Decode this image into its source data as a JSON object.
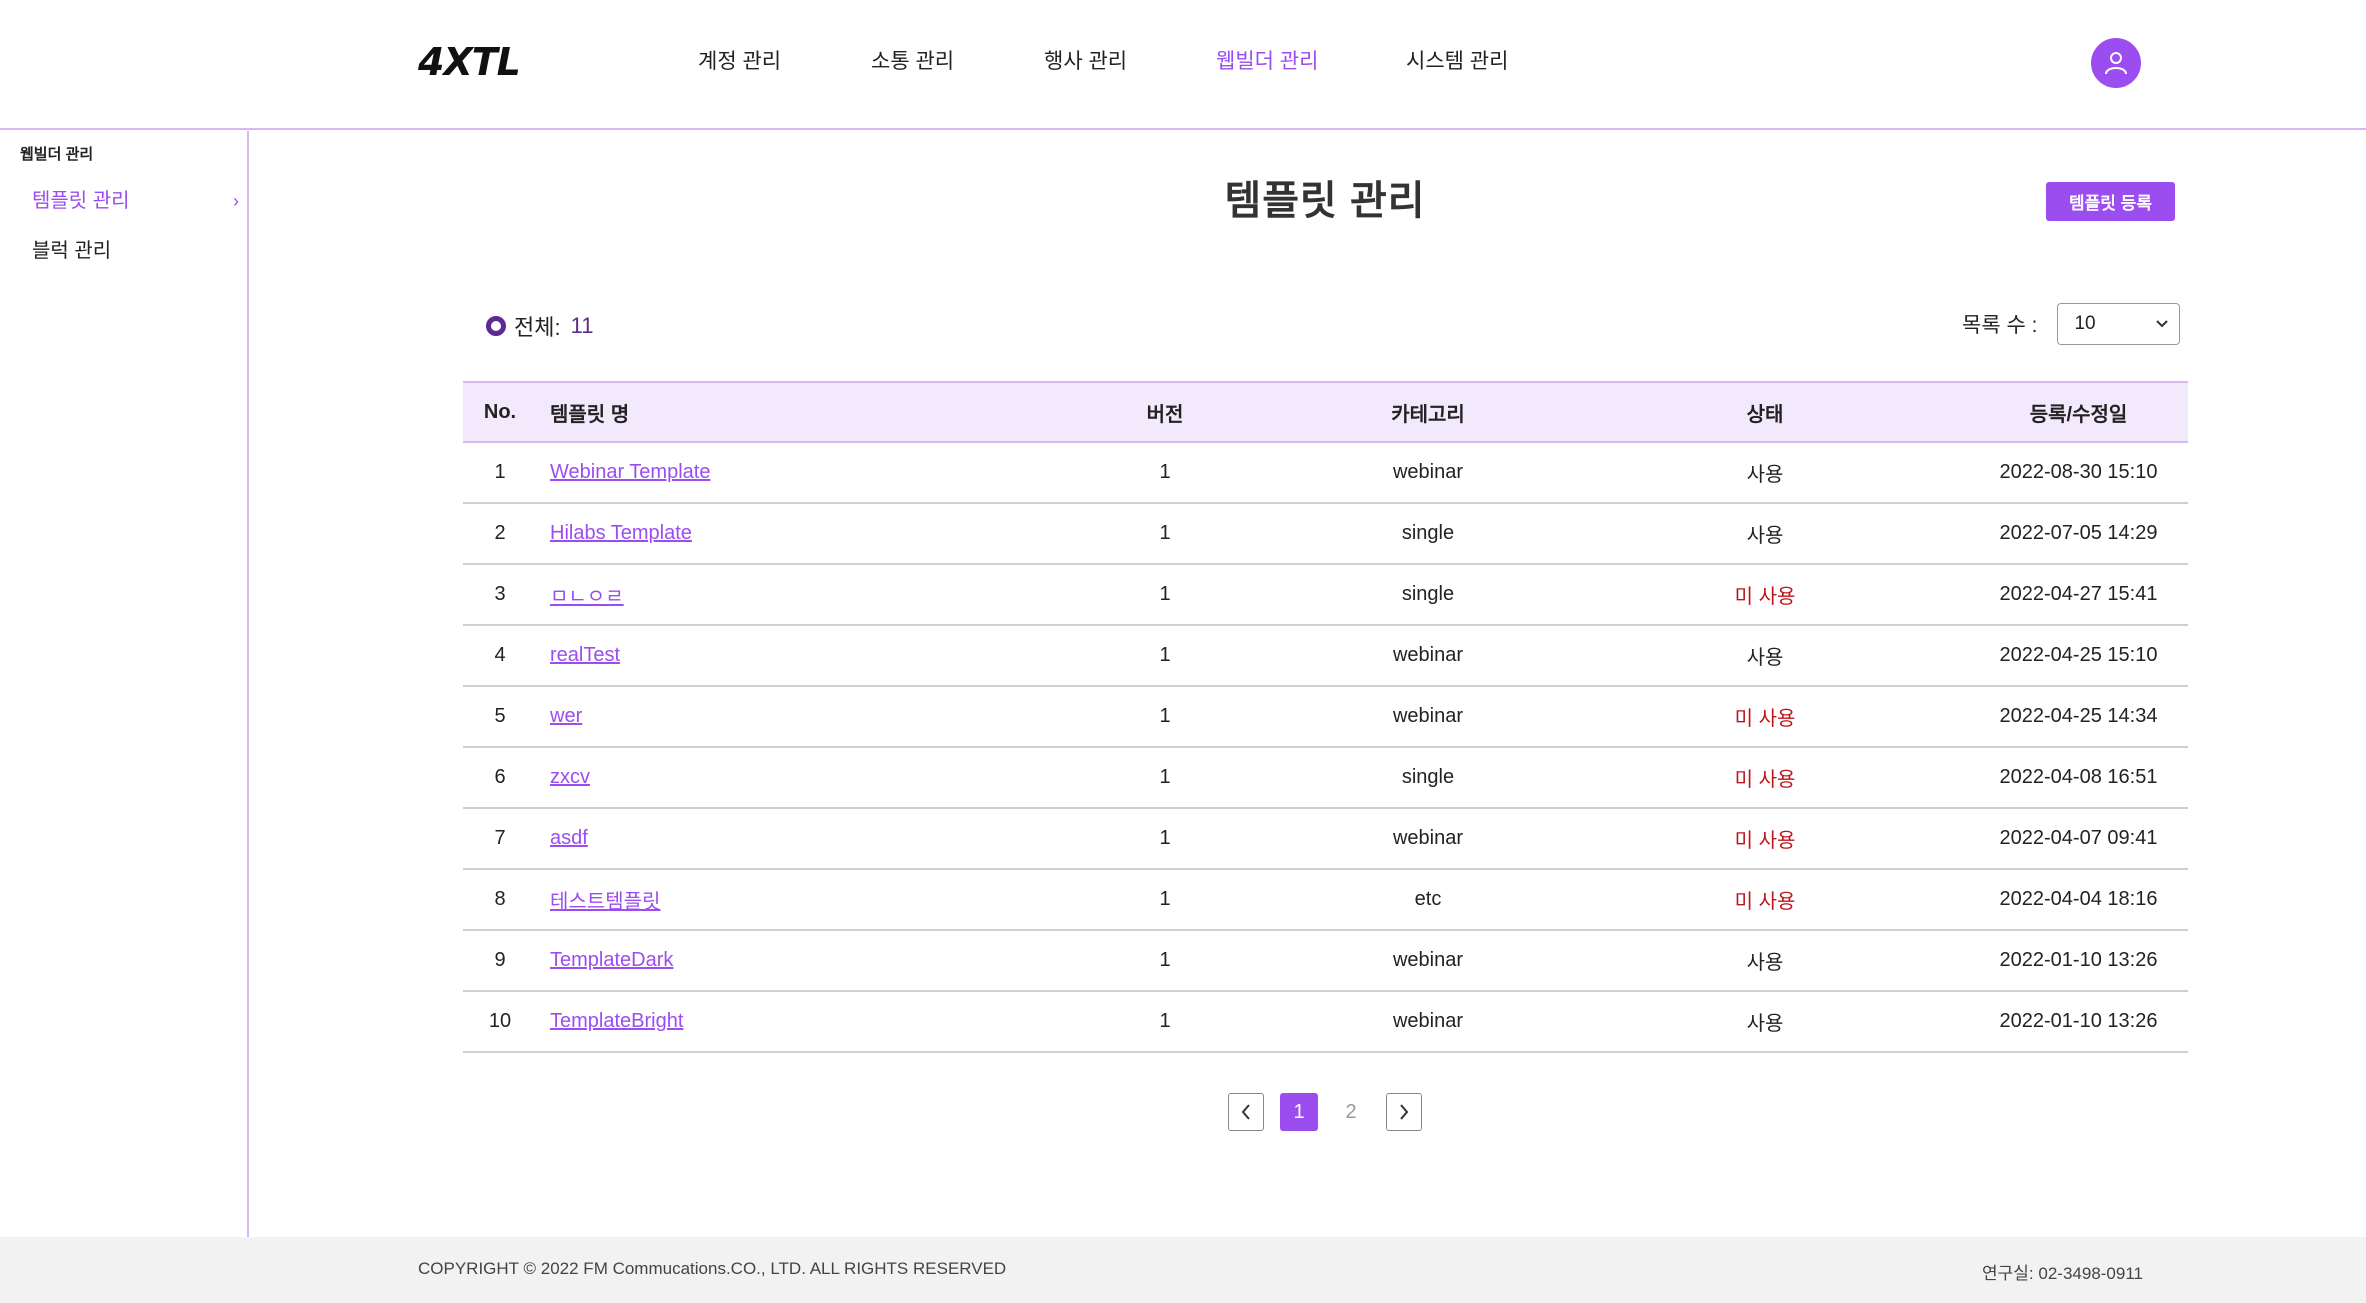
{
  "brand": {
    "logo_a": "4X",
    "logo_b": "TL"
  },
  "nav": [
    {
      "label": "계정 관리"
    },
    {
      "label": "소통 관리"
    },
    {
      "label": "행사 관리"
    },
    {
      "label": "웹빌더 관리",
      "active": true
    },
    {
      "label": "시스템 관리"
    }
  ],
  "sidebar": {
    "title": "웹빌더 관리",
    "items": [
      {
        "label": "템플릿 관리",
        "active": true
      },
      {
        "label": "블럭 관리"
      }
    ]
  },
  "page": {
    "title": "템플릿 관리",
    "register_button": "템플릿 등록",
    "total_label": "전체:",
    "total_count": "11",
    "list_count_label": "목록 수 :",
    "list_count_value": "10"
  },
  "table": {
    "headers": {
      "no": "No.",
      "name": "템플릿 명",
      "version": "버전",
      "category": "카테고리",
      "state": "상태",
      "date": "등록/수정일"
    },
    "rows": [
      {
        "no": "1",
        "name": "Webinar Template",
        "version": "1",
        "category": "webinar",
        "state": "사용",
        "date": "2022-08-30 15:10"
      },
      {
        "no": "2",
        "name": "Hilabs Template",
        "version": "1",
        "category": "single",
        "state": "사용",
        "date": "2022-07-05 14:29"
      },
      {
        "no": "3",
        "name": "ㅁㄴㅇㄹ",
        "version": "1",
        "category": "single",
        "state": "미 사용",
        "date": "2022-04-27 15:41"
      },
      {
        "no": "4",
        "name": "realTest",
        "version": "1",
        "category": "webinar",
        "state": "사용",
        "date": "2022-04-25 15:10"
      },
      {
        "no": "5",
        "name": "wer",
        "version": "1",
        "category": "webinar",
        "state": "미 사용",
        "date": "2022-04-25 14:34"
      },
      {
        "no": "6",
        "name": "zxcv",
        "version": "1",
        "category": "single",
        "state": "미 사용",
        "date": "2022-04-08 16:51"
      },
      {
        "no": "7",
        "name": "asdf",
        "version": "1",
        "category": "webinar",
        "state": "미 사용",
        "date": "2022-04-07 09:41"
      },
      {
        "no": "8",
        "name": "테스트템플릿",
        "version": "1",
        "category": "etc",
        "state": "미 사용",
        "date": "2022-04-04 18:16"
      },
      {
        "no": "9",
        "name": "TemplateDark",
        "version": "1",
        "category": "webinar",
        "state": "사용",
        "date": "2022-01-10 13:26"
      },
      {
        "no": "10",
        "name": "TemplateBright",
        "version": "1",
        "category": "webinar",
        "state": "사용",
        "date": "2022-01-10 13:26"
      }
    ]
  },
  "pagination": {
    "pages": [
      "1",
      "2"
    ],
    "current": "1"
  },
  "footer": {
    "copyright_prefix": "COPYRIGHT",
    "copyright_symbol": "©",
    "copyright_text": "2022 FM Commucations.CO., LTD. ALL RIGHTS RESERVED",
    "contact": "연구실: 02-3498-0911"
  },
  "colors": {
    "accent": "#9b4df0",
    "accent_dark": "#5b2a91",
    "inactive_state": "#c0141b",
    "header_bg": "#f2e9fc",
    "footer_bg": "#f2f2f2"
  },
  "icons": {
    "avatar": "user-icon",
    "prev": "chevron-left-icon",
    "next": "chevron-right-icon",
    "select": "chevron-down-icon"
  }
}
